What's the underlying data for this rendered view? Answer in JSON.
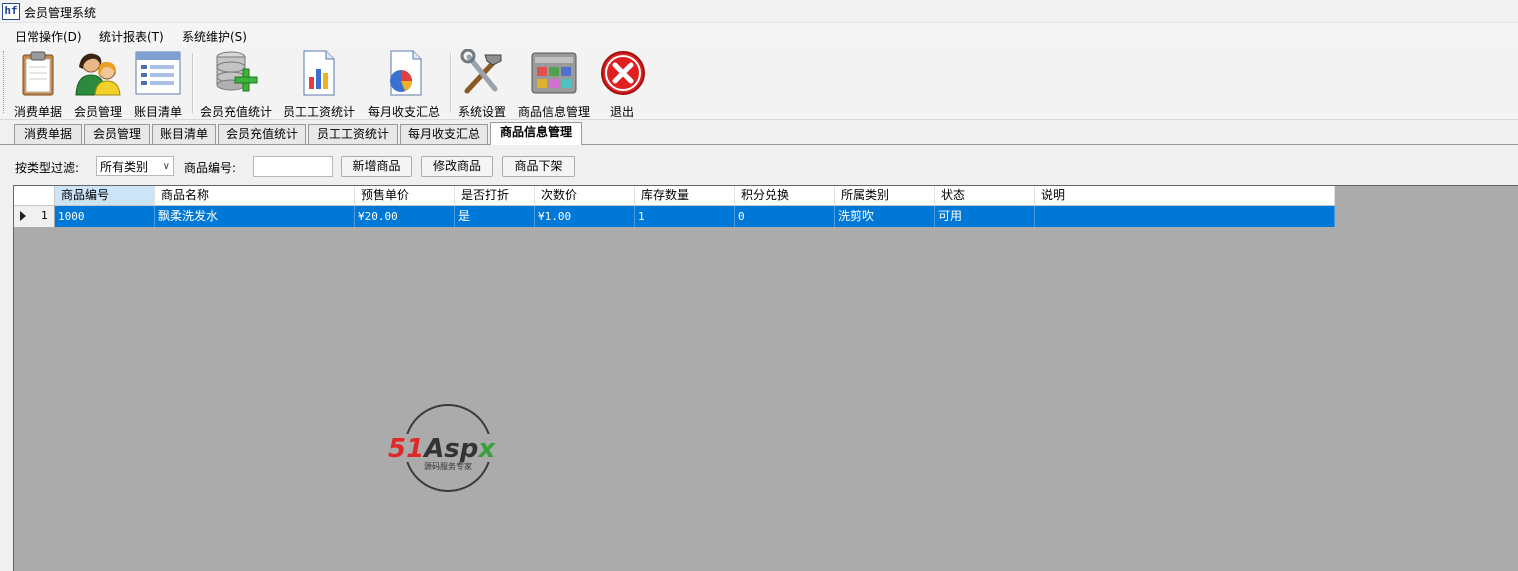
{
  "window": {
    "title": "会员管理系统",
    "app_icon_text": "hf"
  },
  "menu": [
    "日常操作(D)",
    "统计报表(T)",
    "系统维护(S)"
  ],
  "toolbar": {
    "buttons": [
      {
        "label": "消费单据",
        "icon": "clipboard-icon"
      },
      {
        "label": "会员管理",
        "icon": "members-icon"
      },
      {
        "label": "账目清单",
        "icon": "list-icon"
      },
      {
        "label": "会员充值统计",
        "icon": "database-add-icon"
      },
      {
        "label": "员工工资统计",
        "icon": "bar-chart-doc-icon"
      },
      {
        "label": "每月收支汇总",
        "icon": "pie-chart-doc-icon"
      },
      {
        "label": "系统设置",
        "icon": "tools-icon"
      },
      {
        "label": "商品信息管理",
        "icon": "product-grid-icon"
      },
      {
        "label": "退出",
        "icon": "exit-icon"
      }
    ]
  },
  "tabs": [
    {
      "label": "消费单据",
      "active": false
    },
    {
      "label": "会员管理",
      "active": false
    },
    {
      "label": "账目清单",
      "active": false
    },
    {
      "label": "会员充值统计",
      "active": false
    },
    {
      "label": "员工工资统计",
      "active": false
    },
    {
      "label": "每月收支汇总",
      "active": false
    },
    {
      "label": "商品信息管理",
      "active": true
    }
  ],
  "filter": {
    "type_label": "按类型过滤:",
    "type_value": "所有类别",
    "code_label": "商品编号:",
    "code_value": "",
    "add_label": "新增商品",
    "edit_label": "修改商品",
    "remove_label": "商品下架"
  },
  "grid": {
    "columns": [
      "商品编号",
      "商品名称",
      "预售单价",
      "是否打折",
      "次数价",
      "库存数量",
      "积分兑换",
      "所属类别",
      "状态",
      "说明"
    ],
    "rows": [
      {
        "num": "1",
        "cells": [
          "1000",
          "飘柔洗发水",
          "¥20.00",
          "是",
          "¥1.00",
          "1",
          "0",
          "洗剪吹",
          "可用",
          ""
        ]
      }
    ]
  },
  "watermark": {
    "brand": "51Aspx",
    "brand_red": "51",
    "brand_dark": "Asp",
    "brand_green": "x",
    "slogan": "源码服务专家"
  },
  "colors": {
    "selection": "#0078d7",
    "grid_bg": "#ababab",
    "exit_red": "#e02020"
  }
}
